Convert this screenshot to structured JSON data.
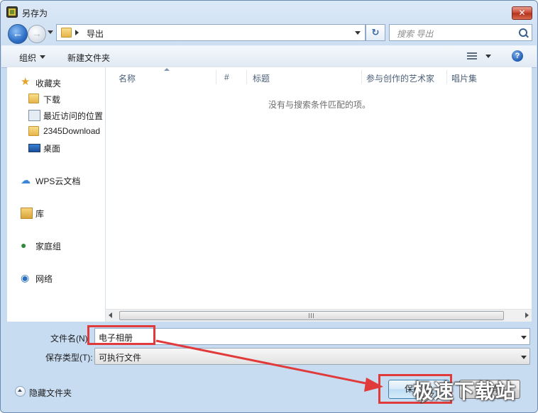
{
  "window": {
    "title": "另存为",
    "close_symbol": "✕"
  },
  "nav": {
    "back_symbol": "←",
    "forward_symbol": "→",
    "address_path": "导出",
    "refresh_symbol": "↻",
    "search_placeholder": "搜索 导出"
  },
  "toolbar": {
    "organize_label": "组织",
    "new_folder_label": "新建文件夹",
    "help_symbol": "?"
  },
  "sidebar": {
    "items": [
      {
        "label": "收藏夹",
        "icon": "star-icon",
        "glyph": "★"
      },
      {
        "label": "下载",
        "icon": "download-folder-icon",
        "glyph": ""
      },
      {
        "label": "最近访问的位置",
        "icon": "recent-places-icon",
        "glyph": ""
      },
      {
        "label": "2345Download",
        "icon": "folder-icon",
        "glyph": ""
      },
      {
        "label": "桌面",
        "icon": "desktop-icon",
        "glyph": ""
      },
      {
        "label": "WPS云文档",
        "icon": "cloud-icon",
        "glyph": "☁"
      },
      {
        "label": "库",
        "icon": "library-icon",
        "glyph": ""
      },
      {
        "label": "家庭组",
        "icon": "homegroup-icon",
        "glyph": "●"
      },
      {
        "label": "网络",
        "icon": "network-icon",
        "glyph": "◉"
      }
    ]
  },
  "file_list": {
    "columns": [
      "名称",
      "#",
      "标题",
      "参与创作的艺术家",
      "唱片集"
    ],
    "empty_message": "没有与搜索条件匹配的项。"
  },
  "form": {
    "filename_label": "文件名(N):",
    "filename_value": "电子相册",
    "filetype_label": "保存类型(T):",
    "filetype_value": "可执行文件"
  },
  "footer": {
    "hide_folders_label": "隐藏文件夹",
    "save_label": "保存(S)",
    "cancel_label": "取消"
  },
  "annotation": {
    "color": "#e03a3a"
  },
  "watermark": {
    "text": "极速下载站"
  }
}
